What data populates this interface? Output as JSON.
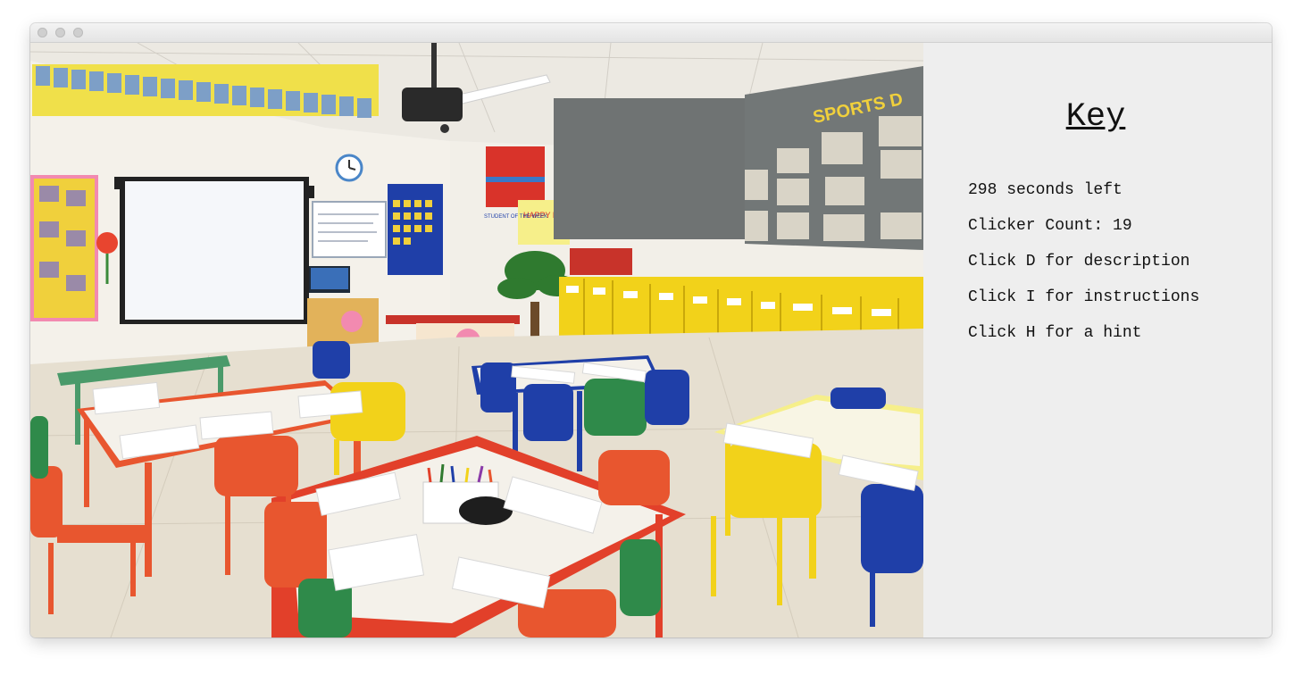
{
  "window": {
    "controls": [
      "close",
      "minimize",
      "zoom"
    ]
  },
  "scene": {
    "description_icon": "classroom-photo",
    "banner_text": "SPORTS D",
    "board_text": "HAPPY BIRTHDAY",
    "sign_text": "STUDENT OF THE WEEK"
  },
  "key": {
    "title": "Key",
    "timer_text": "298 seconds left",
    "clicker_count_text": "Clicker Count: 19",
    "description_text": "Click D for description",
    "instructions_text": "Click I for instructions",
    "hint_text": "Click H for a hint"
  },
  "colors": {
    "panel_bg": "#eeeeee",
    "cabinet_yellow": "#f2d21a",
    "table_red": "#e2402a",
    "chair_blue": "#1f3fa8"
  }
}
